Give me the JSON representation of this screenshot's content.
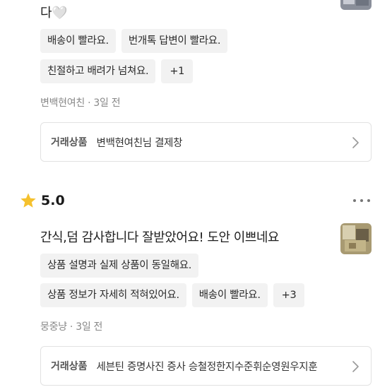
{
  "reviews": [
    {
      "text": "다🤍",
      "tags_row1": [
        "배송이 빨라요.",
        "번개톡 답변이 빨라요."
      ],
      "tags_row2": [
        "친절하고 배려가 넘쳐요."
      ],
      "more": "+1",
      "author": "변백현여친",
      "time": "3일 전",
      "product_label": "거래상품",
      "product_title": "변백현여친님 결제창"
    },
    {
      "rating": "5.0",
      "text": "간식,덤 감사합니다 잘받았어요! 도안 이쁘네요",
      "tags_row1": [
        "상품 설명과 실제 상품이 동일해요."
      ],
      "tags_row2": [
        "상품 정보가 자세히 적혀있어요.",
        "배송이 빨라요."
      ],
      "more": "+3",
      "author": "뭉중냥",
      "time": "3일 전",
      "product_label": "거래상품",
      "product_title": "세븐틴 증명사진 증사 승철정한지수준휘순영원우지훈"
    }
  ],
  "colors": {
    "star": "#F5C12E",
    "tag_bg": "#f2f2f2",
    "meta_text": "#888888",
    "border": "#e2e2e2"
  },
  "icons": {
    "rating": "star-icon",
    "menu": "kebab-menu-icon",
    "product": "chevron-right-icon"
  }
}
